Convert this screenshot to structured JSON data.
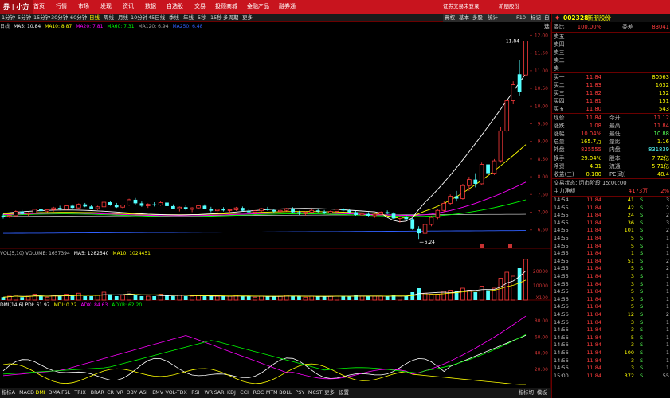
{
  "topbar": {
    "logo": "券 | 小方",
    "nav": [
      "首页",
      "行情",
      "市场",
      "发现",
      "资讯",
      "数据",
      "自选股",
      "交易",
      "投顾商城",
      "金融产品",
      "融券通"
    ],
    "right": [
      "证券交易未登录",
      "新朋股份"
    ]
  },
  "periods": {
    "items": [
      "1分钟",
      "5分钟",
      "15分钟",
      "30分钟",
      "60分钟",
      "日线",
      "周线",
      "月线",
      "10分钟",
      "45日线",
      "季线",
      "年线",
      "5秒",
      "15秒",
      "多周期",
      "更多"
    ],
    "active": "日线"
  },
  "quote_tabs": [
    "買权",
    "基本",
    "多股",
    "统计",
    "F10",
    "标记",
    "自选",
    "资讯"
  ],
  "ma": {
    "prefix": "日线",
    "ma5": "MA5: 10.84",
    "ma10": "MA10: 8.87",
    "ma20": "MA20: 7.81",
    "ma60": "MA60: 7.31",
    "ma120": "MA120: 6.94",
    "ma250": "MA250: 6.48"
  },
  "price_axis": [
    "12.00",
    "11.50",
    "11.00",
    "10.50",
    "10.00",
    "9.50",
    "9.00",
    "8.50",
    "8.00",
    "7.50",
    "7.00",
    "6.50"
  ],
  "annotations": {
    "high": "11.84",
    "low": "6.24"
  },
  "volume": {
    "title": "VOL(5,10)  VOLUME: 1657394",
    "ma5": "MA5: 1282540",
    "ma10": "MA10: 1024451",
    "axis": [
      "20000",
      "10000",
      "X100"
    ]
  },
  "dmi": {
    "title": "DMI(14,6)  PDI: 61.97",
    "mdi": "MDI: 0.22",
    "adx": "ADX: 84.63",
    "adxr": "ADXR: 62.20",
    "axis": [
      "80.00",
      "60.00",
      "40.00",
      "20.00"
    ]
  },
  "bottom_tabs": {
    "items": [
      "指标A",
      "MACD",
      "DMI",
      "DMA",
      "FSL",
      "TRIX",
      "BRAR",
      "CR",
      "VR",
      "OBV",
      "ASI",
      "EMV",
      "VOL-TDX",
      "RSI",
      "WR",
      "SAR",
      "KDJ",
      "CCI",
      "ROC",
      "MTM",
      "BOLL",
      "PSY",
      "MCST",
      "更多",
      "设置"
    ],
    "active": "DMI",
    "right": [
      "指标切",
      "模板"
    ]
  },
  "quote": {
    "code": "002328",
    "name": "新朋股份",
    "webi": {
      "label": "委比",
      "value": "100.00%",
      "label2": "委差",
      "value2": "83041"
    },
    "sell": [
      {
        "label": "卖五",
        "price": "",
        "vol": ""
      },
      {
        "label": "卖四",
        "price": "",
        "vol": ""
      },
      {
        "label": "卖三",
        "price": "",
        "vol": ""
      },
      {
        "label": "卖二",
        "price": "",
        "vol": ""
      },
      {
        "label": "卖一",
        "price": "",
        "vol": ""
      }
    ],
    "buy": [
      {
        "label": "买一",
        "price": "11.84",
        "vol": "80563"
      },
      {
        "label": "买二",
        "price": "11.83",
        "vol": "1632"
      },
      {
        "label": "买三",
        "price": "11.82",
        "vol": "152"
      },
      {
        "label": "买四",
        "price": "11.81",
        "vol": "151"
      },
      {
        "label": "买五",
        "price": "11.80",
        "vol": "543"
      }
    ],
    "stats": [
      {
        "l1": "现价",
        "v1": "11.84",
        "l2": "今开",
        "v2": "11.12"
      },
      {
        "l1": "涨跌",
        "v1": "1.08",
        "l2": "最高",
        "v2": "11.84"
      },
      {
        "l1": "涨幅",
        "v1": "10.04%",
        "l2": "最低",
        "v2": "10.88"
      },
      {
        "l1": "总量",
        "v1": "165.7万",
        "l2": "量比",
        "v2": "1.16"
      },
      {
        "l1": "外盘",
        "v1": "825555",
        "l2": "内盘",
        "v2": "831839"
      }
    ],
    "stats2": [
      {
        "l1": "换手",
        "v1": "29.04%",
        "l2": "股本",
        "v2": "7.72亿"
      },
      {
        "l1": "净资",
        "v1": "4.31",
        "l2": "流通",
        "v2": "5.71亿"
      },
      {
        "l1": "收益(三)",
        "v1": "0.180",
        "l2": "PE(动)",
        "v2": "48.4"
      }
    ],
    "trade_status": "交易状态: 闭市阶段 15:00:00",
    "main_flow": {
      "label": "主力净额",
      "value": "4173万",
      "pct": "2%"
    },
    "ticks": [
      {
        "t": "14:54",
        "p": "11.84",
        "v": "41",
        "d": "S",
        "n": "3"
      },
      {
        "t": "14:55",
        "p": "11.84",
        "v": "42",
        "d": "S",
        "n": "2"
      },
      {
        "t": "14:55",
        "p": "11.84",
        "v": "24",
        "d": "S",
        "n": "2"
      },
      {
        "t": "14:55",
        "p": "11.84",
        "v": "36",
        "d": "S",
        "n": "3"
      },
      {
        "t": "14:55",
        "p": "11.84",
        "v": "101",
        "d": "S",
        "n": "2"
      },
      {
        "t": "14:55",
        "p": "11.84",
        "v": "5",
        "d": "S",
        "n": "1"
      },
      {
        "t": "14:55",
        "p": "11.84",
        "v": "5",
        "d": "S",
        "n": "1"
      },
      {
        "t": "14:55",
        "p": "11.84",
        "v": "1",
        "d": "S",
        "n": "1"
      },
      {
        "t": "14:55",
        "p": "11.84",
        "v": "51",
        "d": "S",
        "n": "2"
      },
      {
        "t": "14:55",
        "p": "11.84",
        "v": "5",
        "d": "S",
        "n": "2"
      },
      {
        "t": "14:55",
        "p": "11.84",
        "v": "3",
        "d": "S",
        "n": "1"
      },
      {
        "t": "14:55",
        "p": "11.84",
        "v": "3",
        "d": "S",
        "n": "1"
      },
      {
        "t": "14:55",
        "p": "11.84",
        "v": "5",
        "d": "S",
        "n": "1"
      },
      {
        "t": "14:56",
        "p": "11.84",
        "v": "3",
        "d": "S",
        "n": "1"
      },
      {
        "t": "14:56",
        "p": "11.84",
        "v": "5",
        "d": "S",
        "n": "1"
      },
      {
        "t": "14:56",
        "p": "11.84",
        "v": "12",
        "d": "S",
        "n": "2"
      },
      {
        "t": "14:56",
        "p": "11.84",
        "v": "3",
        "d": "S",
        "n": "1"
      },
      {
        "t": "14:56",
        "p": "11.84",
        "v": "3",
        "d": "S",
        "n": "1"
      },
      {
        "t": "14:56",
        "p": "11.84",
        "v": "5",
        "d": "S",
        "n": "1"
      },
      {
        "t": "14:56",
        "p": "11.84",
        "v": "3",
        "d": "S",
        "n": "1"
      },
      {
        "t": "14:56",
        "p": "11.84",
        "v": "100",
        "d": "S",
        "n": "1"
      },
      {
        "t": "14:56",
        "p": "11.84",
        "v": "3",
        "d": "S",
        "n": "1"
      },
      {
        "t": "14:56",
        "p": "11.84",
        "v": "3",
        "d": "S",
        "n": "1"
      },
      {
        "t": "15:00",
        "p": "11.84",
        "v": "372",
        "d": "S",
        "n": "55"
      }
    ],
    "bottom": [
      "日线",
      "财"
    ]
  },
  "colors": {
    "up": "#ff3c3c",
    "down": "#54ffff",
    "ma5": "#ffffff",
    "ma10": "#ffff00",
    "ma20": "#ff00ff",
    "ma60": "#00ff00",
    "ma120": "#a0a0a0",
    "ma250": "#3060ff"
  },
  "chart_data": {
    "type": "candlestick",
    "candles": [
      [
        6.9,
        6.95,
        6.82,
        6.88
      ],
      [
        6.88,
        6.92,
        6.84,
        6.9
      ],
      [
        6.9,
        7.05,
        6.88,
        7.02
      ],
      [
        7.02,
        7.06,
        6.92,
        6.95
      ],
      [
        6.95,
        7.0,
        6.9,
        6.97
      ],
      [
        6.97,
        7.1,
        6.95,
        7.08
      ],
      [
        7.08,
        7.12,
        7.0,
        7.03
      ],
      [
        7.03,
        7.1,
        7.0,
        7.07
      ],
      [
        7.07,
        7.15,
        7.02,
        7.12
      ],
      [
        7.12,
        7.18,
        7.05,
        7.08
      ],
      [
        7.08,
        7.2,
        7.06,
        7.18
      ],
      [
        7.18,
        7.22,
        7.1,
        7.12
      ],
      [
        7.12,
        7.25,
        7.1,
        7.22
      ],
      [
        7.22,
        7.26,
        7.14,
        7.16
      ],
      [
        7.16,
        7.2,
        7.08,
        7.1
      ],
      [
        7.1,
        7.18,
        7.06,
        7.15
      ],
      [
        7.15,
        7.3,
        7.12,
        7.28
      ],
      [
        7.28,
        7.32,
        7.18,
        7.2
      ],
      [
        7.2,
        7.26,
        7.12,
        7.14
      ],
      [
        7.14,
        7.22,
        7.1,
        7.2
      ],
      [
        7.2,
        7.38,
        7.18,
        7.35
      ],
      [
        7.35,
        7.4,
        7.22,
        7.25
      ],
      [
        7.25,
        7.3,
        7.15,
        7.18
      ],
      [
        7.18,
        7.25,
        7.12,
        7.22
      ],
      [
        7.22,
        7.28,
        7.16,
        7.2
      ],
      [
        7.2,
        7.3,
        7.18,
        7.27
      ],
      [
        7.27,
        7.3,
        7.15,
        7.17
      ],
      [
        7.17,
        7.22,
        7.08,
        7.1
      ],
      [
        7.1,
        7.16,
        7.02,
        7.14
      ],
      [
        7.14,
        7.2,
        7.05,
        7.08
      ],
      [
        7.08,
        7.14,
        7.0,
        7.12
      ],
      [
        7.12,
        7.2,
        7.08,
        7.18
      ],
      [
        7.18,
        7.22,
        7.08,
        7.1
      ],
      [
        7.1,
        7.15,
        7.0,
        7.04
      ],
      [
        7.04,
        7.1,
        6.98,
        7.08
      ],
      [
        7.08,
        7.14,
        7.02,
        7.05
      ],
      [
        7.05,
        7.1,
        6.98,
        7.07
      ],
      [
        7.07,
        7.15,
        7.04,
        7.12
      ],
      [
        7.12,
        7.16,
        7.02,
        7.04
      ],
      [
        7.04,
        7.08,
        6.96,
        7.0
      ],
      [
        7.0,
        7.06,
        6.94,
        7.04
      ],
      [
        7.04,
        7.12,
        7.0,
        7.1
      ],
      [
        7.1,
        7.15,
        7.04,
        7.06
      ],
      [
        7.06,
        7.1,
        6.98,
        7.02
      ],
      [
        7.02,
        7.08,
        6.95,
        7.05
      ],
      [
        7.05,
        7.12,
        7.02,
        7.1
      ],
      [
        7.1,
        7.14,
        6.98,
        7.0
      ],
      [
        7.0,
        7.04,
        6.92,
        6.96
      ],
      [
        6.96,
        7.02,
        6.9,
        7.0
      ],
      [
        7.0,
        7.08,
        6.96,
        7.05
      ],
      [
        7.05,
        7.1,
        6.98,
        7.02
      ],
      [
        7.02,
        7.06,
        6.94,
        6.98
      ],
      [
        6.98,
        7.05,
        6.94,
        7.02
      ],
      [
        7.02,
        7.1,
        6.98,
        7.08
      ],
      [
        7.08,
        7.12,
        7.02,
        7.05
      ],
      [
        7.05,
        7.08,
        6.96,
        7.0
      ],
      [
        7.0,
        7.04,
        6.9,
        6.92
      ],
      [
        6.92,
        6.98,
        6.86,
        6.95
      ],
      [
        6.95,
        7.0,
        6.88,
        6.9
      ],
      [
        6.9,
        6.96,
        6.84,
        6.94
      ],
      [
        6.94,
        7.02,
        6.92,
        7.0
      ],
      [
        7.0,
        7.05,
        6.94,
        6.96
      ],
      [
        6.96,
        7.0,
        6.8,
        6.82
      ],
      [
        6.82,
        6.9,
        6.7,
        6.86
      ],
      [
        6.86,
        6.92,
        6.78,
        6.8
      ],
      [
        6.8,
        6.86,
        6.5,
        6.52
      ],
      [
        6.52,
        6.6,
        6.24,
        6.4
      ],
      [
        6.4,
        6.7,
        6.35,
        6.65
      ],
      [
        6.65,
        6.9,
        6.6,
        6.85
      ],
      [
        6.85,
        7.1,
        6.8,
        7.05
      ],
      [
        7.05,
        7.3,
        7.0,
        7.25
      ],
      [
        7.25,
        7.5,
        7.2,
        7.45
      ],
      [
        7.45,
        7.6,
        7.3,
        7.38
      ],
      [
        7.38,
        7.8,
        7.35,
        7.75
      ],
      [
        7.75,
        8.0,
        7.6,
        7.92
      ],
      [
        7.92,
        8.1,
        7.7,
        7.8
      ],
      [
        7.8,
        8.4,
        7.78,
        8.35
      ],
      [
        8.35,
        8.6,
        8.0,
        8.1
      ],
      [
        8.1,
        8.5,
        8.05,
        8.45
      ],
      [
        8.45,
        9.4,
        8.4,
        9.3
      ],
      [
        9.3,
        10.2,
        9.25,
        10.15
      ],
      [
        10.15,
        10.7,
        10.05,
        10.6
      ],
      [
        10.9,
        11.3,
        10.3,
        10.4
      ],
      [
        10.88,
        11.84,
        10.88,
        11.84
      ]
    ],
    "ma": {
      "ma5": {
        "from": 6.97,
        "to": 10.84
      },
      "ma10": {
        "from": 6.95,
        "to": 8.87
      },
      "ma20": {
        "from": 6.93,
        "to": 7.81
      },
      "ma60": {
        "from": 6.91,
        "to": 7.31
      },
      "ma120": {
        "from": 6.88,
        "to": 6.94
      },
      "ma250": {
        "from": 6.4,
        "to": 6.48
      }
    },
    "volume": [
      3,
      4,
      5,
      3,
      4,
      6,
      4,
      3,
      5,
      4,
      6,
      5,
      7,
      4,
      4,
      5,
      8,
      6,
      4,
      5,
      9,
      5,
      4,
      4,
      4,
      6,
      5,
      4,
      5,
      4,
      4,
      5,
      4,
      4,
      4,
      4,
      4,
      5,
      4,
      4,
      3,
      4,
      4,
      4,
      4,
      5,
      4,
      4,
      3,
      4,
      4,
      4,
      4,
      4,
      4,
      4,
      5,
      4,
      4,
      4,
      4,
      4,
      5,
      4,
      4,
      8,
      12,
      7,
      6,
      6,
      9,
      10,
      9,
      12,
      10,
      8,
      14,
      10,
      12,
      22,
      28,
      24,
      32,
      41
    ],
    "ylim": [
      6.2,
      12.1
    ]
  }
}
